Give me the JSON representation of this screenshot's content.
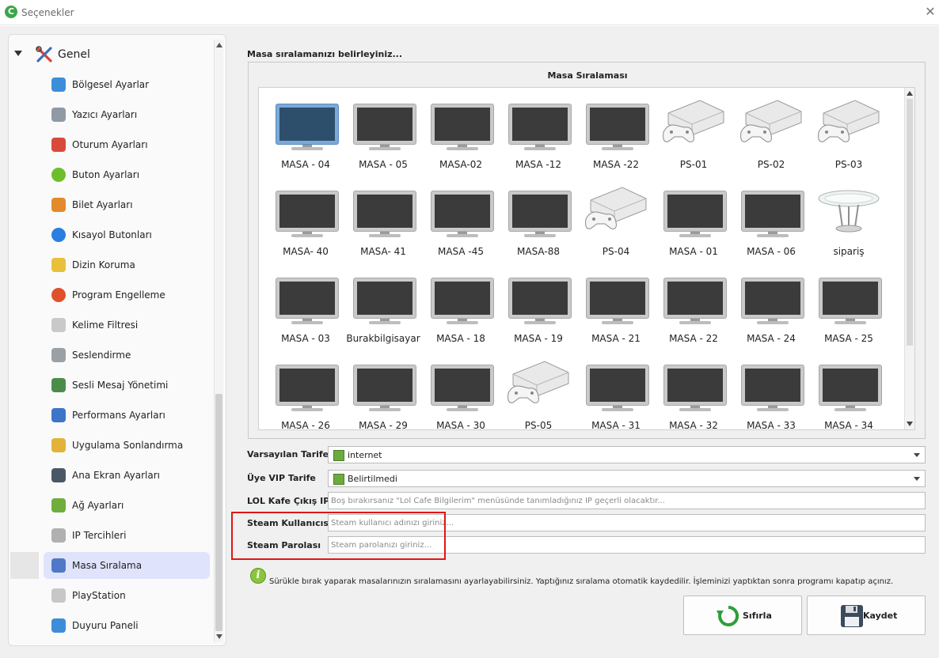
{
  "window": {
    "title": "Seçenekler",
    "app_icon_glyph": "C",
    "close_glyph": "✕"
  },
  "sidebar": {
    "root": {
      "label": "Genel",
      "icon": "tools-icon"
    },
    "items": [
      {
        "label": "Bölgesel Ayarlar",
        "icon": "region-icon",
        "color": "#3d8ed8"
      },
      {
        "label": "Yazıcı Ayarları",
        "icon": "printer-icon",
        "color": "#8f9aa5"
      },
      {
        "label": "Oturum Ayarları",
        "icon": "tools-icon",
        "color": "#d84b3b"
      },
      {
        "label": "Buton Ayarları",
        "icon": "check-icon",
        "color": "#6cbf2a"
      },
      {
        "label": "Bilet Ayarları",
        "icon": "ticket-icon",
        "color": "#e38a2b"
      },
      {
        "label": "Kısayol Butonları",
        "icon": "play-icon",
        "color": "#2a7de1"
      },
      {
        "label": "Dizin Koruma",
        "icon": "folder-shield-icon",
        "color": "#e9c03a"
      },
      {
        "label": "Program Engelleme",
        "icon": "block-icon",
        "color": "#e0502a"
      },
      {
        "label": "Kelime Filtresi",
        "icon": "filter-icon",
        "color": "#c9c9c9"
      },
      {
        "label": "Seslendirme",
        "icon": "speaker-icon",
        "color": "#9aa0a6"
      },
      {
        "label": "Sesli Mesaj Yönetimi",
        "icon": "headset-icon",
        "color": "#4a8d4a"
      },
      {
        "label": "Performans Ayarları",
        "icon": "chart-icon",
        "color": "#3d75c9"
      },
      {
        "label": "Uygulama Sonlandırma",
        "icon": "broom-icon",
        "color": "#e3b23a"
      },
      {
        "label": "Ana Ekran Ayarları",
        "icon": "monitor-icon",
        "color": "#4a5866"
      },
      {
        "label": "Ağ Ayarları",
        "icon": "network-icon",
        "color": "#6fae3c"
      },
      {
        "label": "IP Tercihleri",
        "icon": "ip-icon",
        "color": "#b0b0b0"
      },
      {
        "label": "Masa Sıralama",
        "icon": "grid-icon",
        "color": "#4f78c7",
        "selected": true
      },
      {
        "label": "PlayStation",
        "icon": "gamepad-icon",
        "color": "#c7c7c7"
      },
      {
        "label": "Duyuru Paneli",
        "icon": "mail-icon",
        "color": "#3d8ed8"
      }
    ]
  },
  "main": {
    "heading": "Masa sıralamanızı belirleyiniz...",
    "group_title": "Masa Sıralaması",
    "tiles": [
      [
        "MASA - 04",
        "MASA - 05",
        "MASA-02",
        "MASA -12",
        "MASA -22",
        "PS-01",
        "PS-02",
        "PS-03"
      ],
      [
        "MASA- 40",
        "MASA- 41",
        "MASA -45",
        "MASA-88",
        "PS-04",
        "MASA - 01",
        "MASA - 06",
        "sipariş"
      ],
      [
        "MASA - 03",
        "Burakbilgisayar",
        "MASA - 18",
        "MASA - 19",
        "MASA - 21",
        "MASA - 22",
        "MASA - 24",
        "MASA - 25"
      ],
      [
        "MASA - 26",
        "MASA - 29",
        "MASA - 30",
        "PS-05",
        "MASA - 31",
        "MASA - 32",
        "MASA - 33",
        "MASA - 34"
      ]
    ],
    "tile_types": [
      [
        "monitor-selected",
        "monitor",
        "monitor",
        "monitor",
        "monitor",
        "ps",
        "ps",
        "ps"
      ],
      [
        "monitor",
        "monitor",
        "monitor",
        "monitor",
        "ps",
        "monitor",
        "monitor",
        "table"
      ],
      [
        "monitor",
        "monitor",
        "monitor",
        "monitor",
        "monitor",
        "monitor",
        "monitor",
        "monitor"
      ],
      [
        "monitor",
        "monitor",
        "monitor",
        "ps",
        "monitor",
        "monitor",
        "monitor",
        "monitor"
      ]
    ],
    "form": {
      "default_tariff": {
        "label": "Varsayılan Tarife",
        "value": "internet"
      },
      "vip_tariff": {
        "label": "Üye VIP Tarife",
        "value": "Belirtilmedi"
      },
      "exit_ip": {
        "label": "LOL Kafe Çıkış IP",
        "placeholder": "Boş bırakırsanız \"Lol Cafe Bilgilerim\" menüsünde tanımladığınız IP geçerli olacaktır..."
      },
      "steam_user": {
        "label": "Steam Kullanıcısı",
        "placeholder": "Steam kullanıcı adınızı giriniz..."
      },
      "steam_pass": {
        "label": "Steam Parolası",
        "placeholder": "Steam parolanızı giriniz..."
      }
    },
    "info_text": "Sürükle bırak yaparak masalarınızın sıralamasını ayarlayabilirsiniz. Yaptığınız sıralama otomatik kaydedilir. İşleminizi yaptıktan sonra programı kapatıp açınız.",
    "buttons": {
      "reset": "Sıfırla",
      "save": "Kaydet"
    },
    "highlight_color": "#e01616"
  }
}
